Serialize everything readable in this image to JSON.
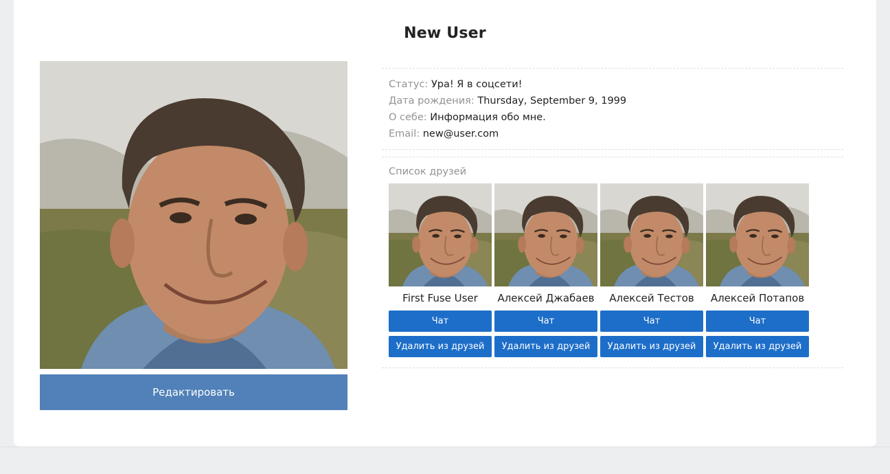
{
  "profile": {
    "name": "New User",
    "edit_label": "Редактировать",
    "status_label": "Статус:",
    "status_value": "Ура! Я в соцсети!",
    "birth_label": "Дата рождения:",
    "birth_value": "Thursday, September 9, 1999",
    "about_label": "О себе:",
    "about_value": "Информация обо мне.",
    "email_label": "Email:",
    "email_value": "new@user.com"
  },
  "friends": {
    "title": "Список друзей",
    "chat_label": "Чат",
    "remove_label": "Удалить из друзей",
    "items": [
      {
        "name": "First Fuse User"
      },
      {
        "name": "Алексей Джабаев"
      },
      {
        "name": "Алексей Тестов"
      },
      {
        "name": "Алексей Потапов"
      }
    ]
  },
  "colors": {
    "edit_button": "#5181b8",
    "friend_button": "#1d6ec9",
    "label_gray": "#939393",
    "page_bg": "#edeef0"
  }
}
